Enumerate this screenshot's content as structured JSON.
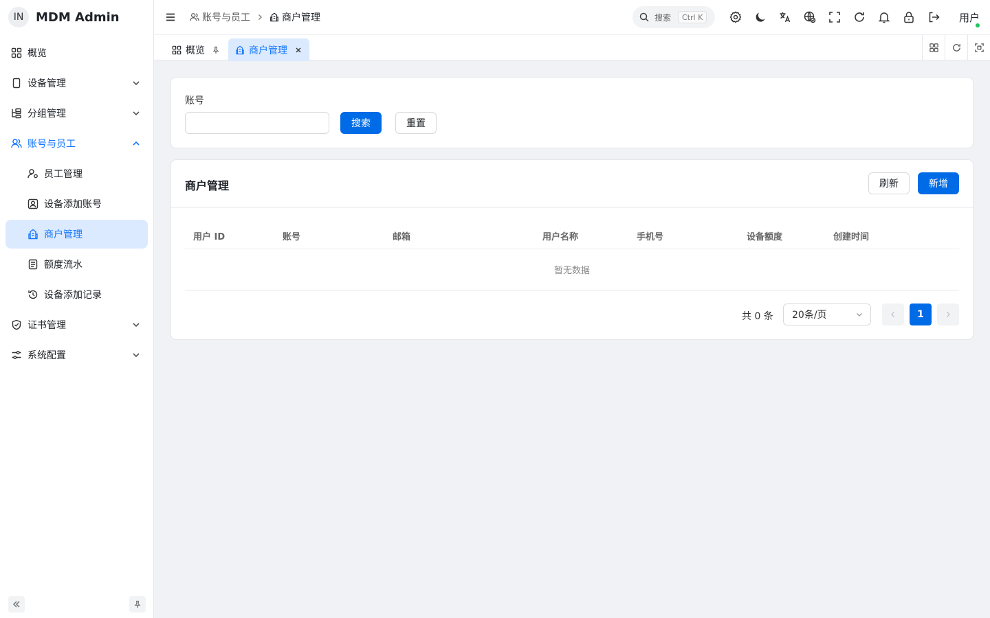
{
  "brand": {
    "logo_text": "IN",
    "title": "MDM Admin"
  },
  "sidebar": {
    "items": [
      {
        "label": "概览",
        "icon": "dashboard-icon"
      },
      {
        "label": "设备管理",
        "icon": "device-icon",
        "expandable": true
      },
      {
        "label": "分组管理",
        "icon": "group-tree-icon",
        "expandable": true
      },
      {
        "label": "账号与员工",
        "icon": "users-icon",
        "expandable": true,
        "open": true
      },
      {
        "label": "员工管理",
        "icon": "user-gear-icon",
        "sub": true
      },
      {
        "label": "设备添加账号",
        "icon": "device-account-icon",
        "sub": true
      },
      {
        "label": "商户管理",
        "icon": "merchant-icon",
        "sub": true,
        "active": true
      },
      {
        "label": "额度流水",
        "icon": "ledger-icon",
        "sub": true
      },
      {
        "label": "设备添加记录",
        "icon": "history-icon",
        "sub": true
      },
      {
        "label": "证书管理",
        "icon": "shield-icon",
        "expandable": true
      },
      {
        "label": "系统配置",
        "icon": "sliders-icon",
        "expandable": true
      }
    ]
  },
  "header": {
    "breadcrumb": [
      "账号与员工",
      "商户管理"
    ],
    "search_placeholder": "搜索",
    "search_shortcut": "Ctrl K",
    "user_label": "用户"
  },
  "tabs": [
    {
      "label": "概览",
      "active": false
    },
    {
      "label": "商户管理",
      "active": true
    }
  ],
  "filter": {
    "account_label": "账号",
    "account_value": "",
    "search_button": "搜索",
    "reset_button": "重置"
  },
  "table_card": {
    "title": "商户管理",
    "refresh_button": "刷新",
    "add_button": "新增",
    "columns": [
      "用户 ID",
      "账号",
      "邮箱",
      "用户名称",
      "手机号",
      "设备额度",
      "创建时间"
    ],
    "rows": [],
    "empty_text": "暂无数据"
  },
  "pagination": {
    "total_text": "共 0 条",
    "page_size": "20条/页",
    "current_page": "1"
  },
  "colors": {
    "primary": "#006be6",
    "active_bg": "#dbeafe",
    "accent_text": "#1677ff",
    "online": "#22c55e"
  }
}
